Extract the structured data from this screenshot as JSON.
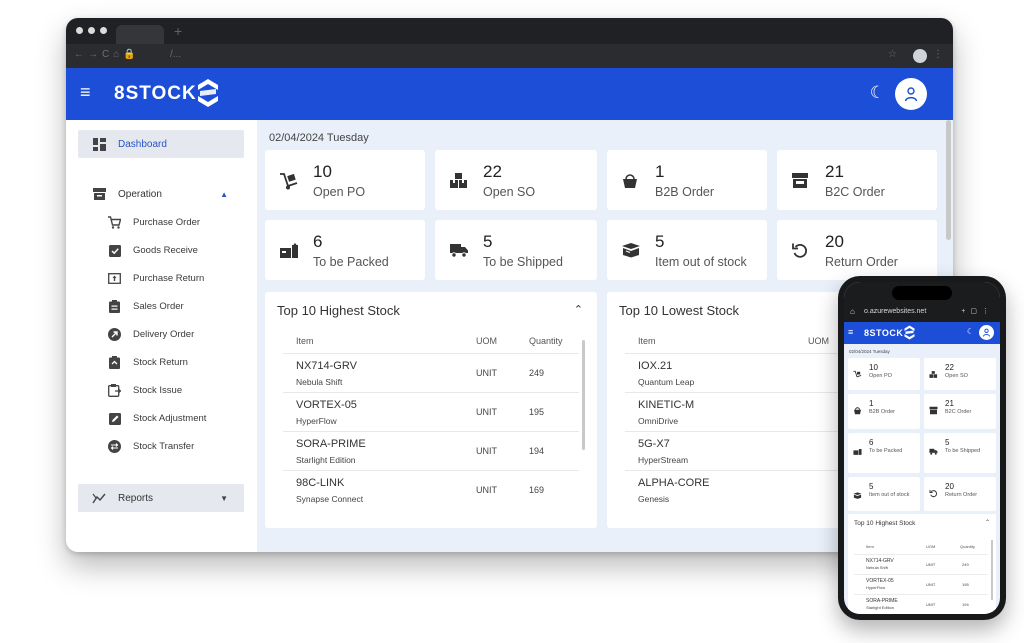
{
  "browser": {
    "address": "/..."
  },
  "brand": {
    "name": "8STOCK",
    "primary_color": "#1d4ed8"
  },
  "sidebar": {
    "dashboard": "Dashboard",
    "operation": "Operation",
    "items": [
      {
        "label": "Purchase Order",
        "icon": "cart-icon"
      },
      {
        "label": "Goods Receive",
        "icon": "checkbox-icon"
      },
      {
        "label": "Purchase Return",
        "icon": "return-box-icon"
      },
      {
        "label": "Sales Order",
        "icon": "clipboard-icon"
      },
      {
        "label": "Delivery Order",
        "icon": "arrow-circle-icon"
      },
      {
        "label": "Stock Return",
        "icon": "stock-return-icon"
      },
      {
        "label": "Stock Issue",
        "icon": "stock-issue-icon"
      },
      {
        "label": "Stock Adjustment",
        "icon": "edit-square-icon"
      },
      {
        "label": "Stock Transfer",
        "icon": "transfer-icon"
      }
    ],
    "reports": "Reports"
  },
  "dashboard": {
    "date": "02/04/2024 Tuesday",
    "stats": [
      {
        "value": "10",
        "label": "Open PO",
        "icon": "hand-truck-icon"
      },
      {
        "value": "22",
        "label": "Open SO",
        "icon": "boxes-icon"
      },
      {
        "value": "1",
        "label": "B2B Order",
        "icon": "basket-icon"
      },
      {
        "value": "21",
        "label": "B2C Order",
        "icon": "store-icon"
      },
      {
        "value": "6",
        "label": "To be Packed",
        "icon": "packing-icon"
      },
      {
        "value": "5",
        "label": "To be Shipped",
        "icon": "truck-icon"
      },
      {
        "value": "5",
        "label": "Item out of stock",
        "icon": "open-box-icon"
      },
      {
        "value": "20",
        "label": "Return Order",
        "icon": "undo-icon"
      }
    ],
    "highest": {
      "title": "Top 10 Highest Stock",
      "columns": [
        "Item",
        "UOM",
        "Quantity"
      ],
      "rows": [
        {
          "code": "NX714-GRV",
          "name": "Nebula Shift",
          "uom": "UNIT",
          "qty": "249"
        },
        {
          "code": "VORTEX-05",
          "name": "HyperFlow",
          "uom": "UNIT",
          "qty": "195"
        },
        {
          "code": "SORA-PRIME",
          "name": "Starlight Edition",
          "uom": "UNIT",
          "qty": "194"
        },
        {
          "code": "98C-LINK",
          "name": "Synapse Connect",
          "uom": "UNIT",
          "qty": "169"
        }
      ]
    },
    "lowest": {
      "title": "Top 10 Lowest Stock",
      "columns": [
        "Item",
        "UOM"
      ],
      "rows": [
        {
          "code": "IOX.21",
          "name": "Quantum Leap"
        },
        {
          "code": "KINETIC-M",
          "name": "OmniDrive"
        },
        {
          "code": "5G-X7",
          "name": "HyperStream"
        },
        {
          "code": "ALPHA-CORE",
          "name": "Genesis"
        }
      ]
    }
  },
  "phone": {
    "url": "o.azurewebsites.net",
    "stats": [
      {
        "value": "10",
        "label": "Open PO"
      },
      {
        "value": "22",
        "label": "Open SO"
      },
      {
        "value": "1",
        "label": "B2B Order"
      },
      {
        "value": "21",
        "label": "B2C Order"
      },
      {
        "value": "6",
        "label": "To be Packed"
      },
      {
        "value": "5",
        "label": "To be Shipped"
      },
      {
        "value": "5",
        "label": "Item out of stock"
      },
      {
        "value": "20",
        "label": "Return Order"
      }
    ],
    "rows": [
      {
        "code": "NX714-GRV",
        "name": "Nebula Shift",
        "uom": "UNIT",
        "qty": "249"
      },
      {
        "code": "VORTEX-05",
        "name": "HyperFlow",
        "uom": "UNIT",
        "qty": "195"
      },
      {
        "code": "SORA-PRIME",
        "name": "Starlight Edition",
        "uom": "UNIT",
        "qty": "194"
      }
    ]
  }
}
